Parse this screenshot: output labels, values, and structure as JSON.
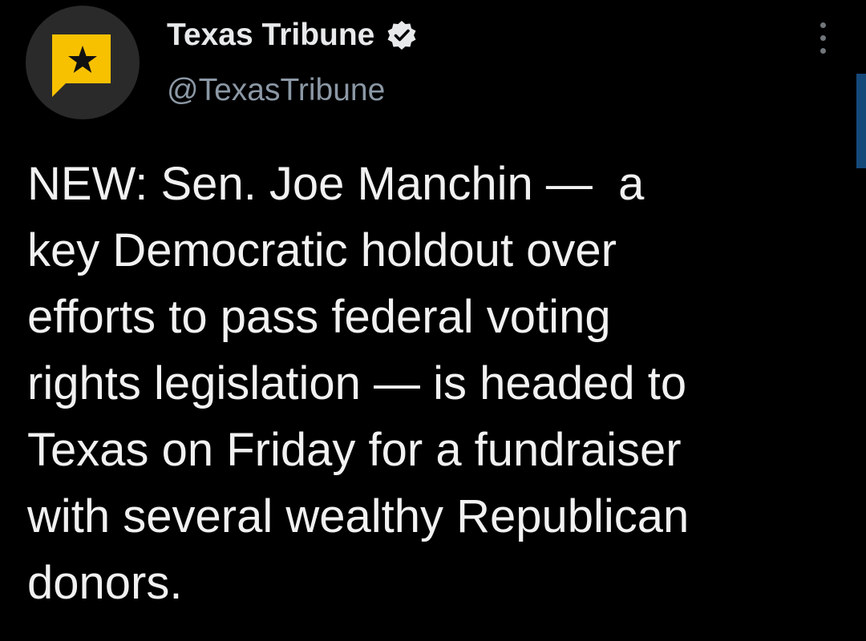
{
  "author": {
    "display_name": "Texas Tribune",
    "handle": "@TexasTribune",
    "verified": true,
    "avatar_icon": "star-speech-bubble-logo",
    "avatar_bg": "#2a2a2a",
    "logo_color": "#f8c100"
  },
  "menu": {
    "icon": "more-vertical-icon"
  },
  "tweet": {
    "lines": [
      "NEW: Sen. Joe Manchin —  a",
      "key Democratic holdout over",
      "efforts to pass federal voting",
      "rights legislation — is headed to",
      "Texas on Friday for a fundraiser",
      "with several wealthy Republican",
      "donors."
    ]
  },
  "colors": {
    "background": "#000000",
    "text": "#f1f1f1",
    "secondary_text": "#8b98a5",
    "accent": "#15497a"
  }
}
